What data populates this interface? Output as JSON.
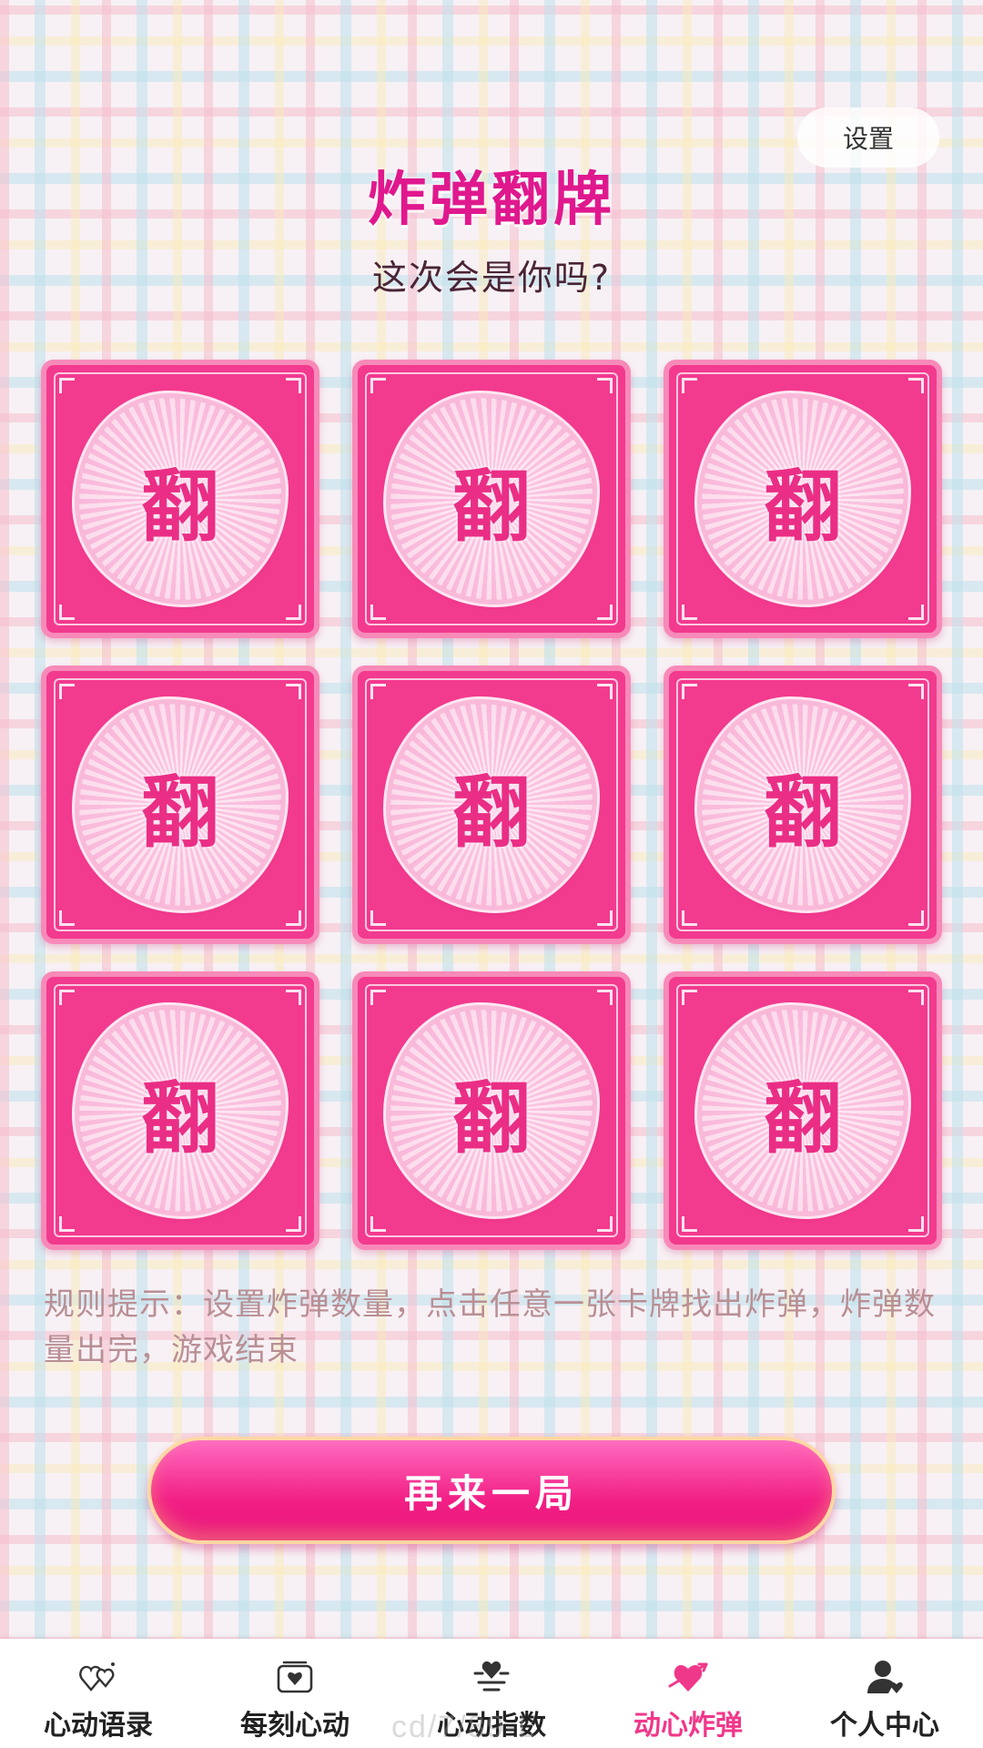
{
  "header": {
    "settings_label": "设置",
    "title": "炸弹翻牌",
    "subtitle": "这次会是你吗?"
  },
  "cards": [
    {
      "label": "翻"
    },
    {
      "label": "翻"
    },
    {
      "label": "翻"
    },
    {
      "label": "翻"
    },
    {
      "label": "翻"
    },
    {
      "label": "翻"
    },
    {
      "label": "翻"
    },
    {
      "label": "翻"
    },
    {
      "label": "翻"
    }
  ],
  "rules_text": "规则提示：设置炸弹数量，点击任意一张卡牌找出炸弹，炸弹数量出完，游戏结束",
  "restart_label": "再来一局",
  "tabbar": {
    "items": [
      {
        "label": "心动语录",
        "icon": "hearts-icon"
      },
      {
        "label": "每刻心动",
        "icon": "heart-frame-icon"
      },
      {
        "label": "心动指数",
        "icon": "heart-gauge-icon"
      },
      {
        "label": "动心炸弹",
        "icon": "arrow-heart-icon"
      },
      {
        "label": "个人中心",
        "icon": "user-icon"
      }
    ],
    "active_index": 3
  },
  "watermark": "cd/7/89-L",
  "colors": {
    "title": "#e0188e",
    "card": "#f23a8e",
    "active_tab": "#f0388a",
    "button": "#f21f85"
  }
}
